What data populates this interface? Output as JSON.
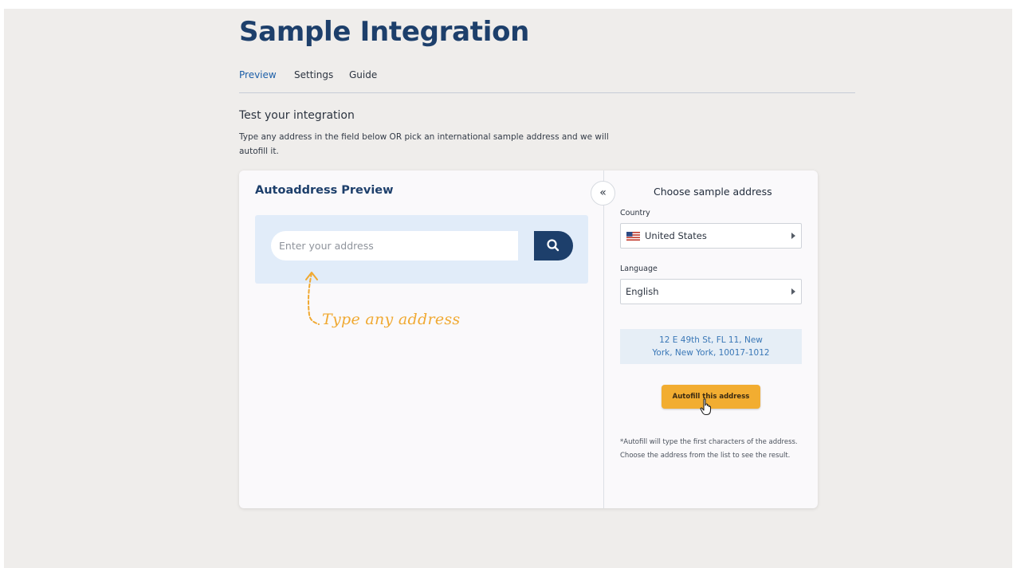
{
  "page": {
    "title": "Sample Integration",
    "tabs": [
      {
        "label": "Preview",
        "active": true
      },
      {
        "label": "Settings",
        "active": false
      },
      {
        "label": "Guide",
        "active": false
      }
    ],
    "section_title": "Test your integration",
    "section_desc": "Type any address in the field below OR pick an international sample address and we will autofill it."
  },
  "preview": {
    "title": "Autoaddress Preview",
    "search_placeholder": "Enter your address",
    "search_icon": "search-icon",
    "hint": "Type any address"
  },
  "sample": {
    "collapse_glyph": "«",
    "title": "Choose sample address",
    "country_label": "Country",
    "country_value": "United States",
    "country_flag": "us-flag-icon",
    "language_label": "Language",
    "language_value": "English",
    "address_line1": "12 E 49th St, FL 11, New",
    "address_line2": "York, New York, 10017-1012",
    "autofill_label": "Autofill this address",
    "footnote": "*Autofill will type the first characters of the address. Choose the address from the list to see the result."
  },
  "colors": {
    "brand": "#1d3f6b",
    "accent": "#f2ad31",
    "link": "#3b78b7",
    "panel": "#e1ecf9"
  }
}
